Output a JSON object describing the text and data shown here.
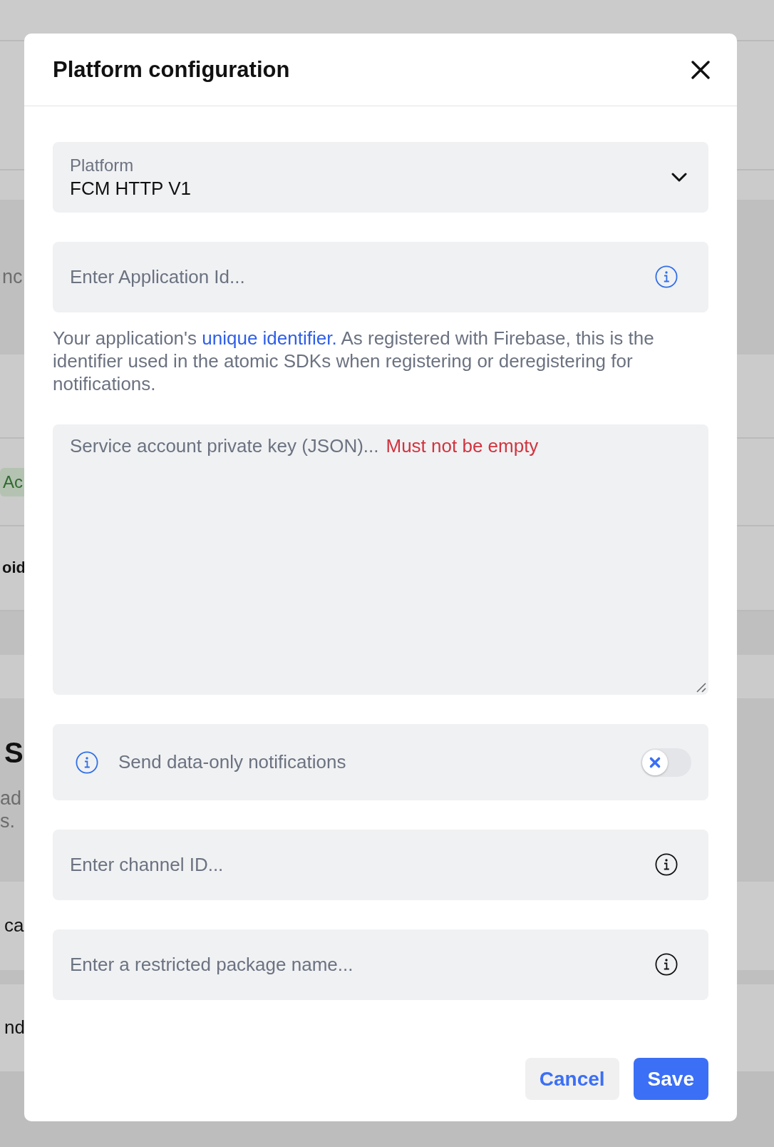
{
  "background": {
    "fragments": [
      {
        "kind": "muted",
        "text": "nc"
      },
      {
        "kind": "badge",
        "text": "Ac"
      },
      {
        "kind": "strong",
        "text": "oid"
      },
      {
        "kind": "heading",
        "text": "S"
      },
      {
        "kind": "muted",
        "text": "ad"
      },
      {
        "kind": "muted",
        "text": "s."
      },
      {
        "kind": "plain",
        "text": "ca"
      },
      {
        "kind": "plain",
        "text": "nd"
      }
    ]
  },
  "dialog": {
    "title": "Platform configuration",
    "form": [
      {
        "kind": "select",
        "label": "Platform",
        "value": "FCM HTTP V1"
      },
      {
        "kind": "input",
        "placeholder": "Enter Application Id...",
        "color": "#2f6fe8"
      },
      {
        "kind": "help",
        "text_before": "Your application's ",
        "link": "unique identifier.",
        "text_after": " As registered with Firebase, this is the identifier used in the atomic SDKs when registering or deregistering for notifications."
      },
      {
        "kind": "textarea",
        "placeholder": "Service account private key (JSON)...",
        "error": "Must not be empty"
      },
      {
        "kind": "toggle",
        "label": "Send data-only notifications",
        "on": false,
        "color": "#2f6fe8"
      },
      {
        "kind": "input",
        "placeholder": "Enter channel ID...",
        "color": "#111111"
      },
      {
        "kind": "input",
        "placeholder": "Enter a restricted package name...",
        "color": "#111111"
      }
    ],
    "buttons": [
      {
        "kind": "secondary",
        "label": "Cancel"
      },
      {
        "kind": "primary",
        "label": "Save"
      }
    ]
  }
}
